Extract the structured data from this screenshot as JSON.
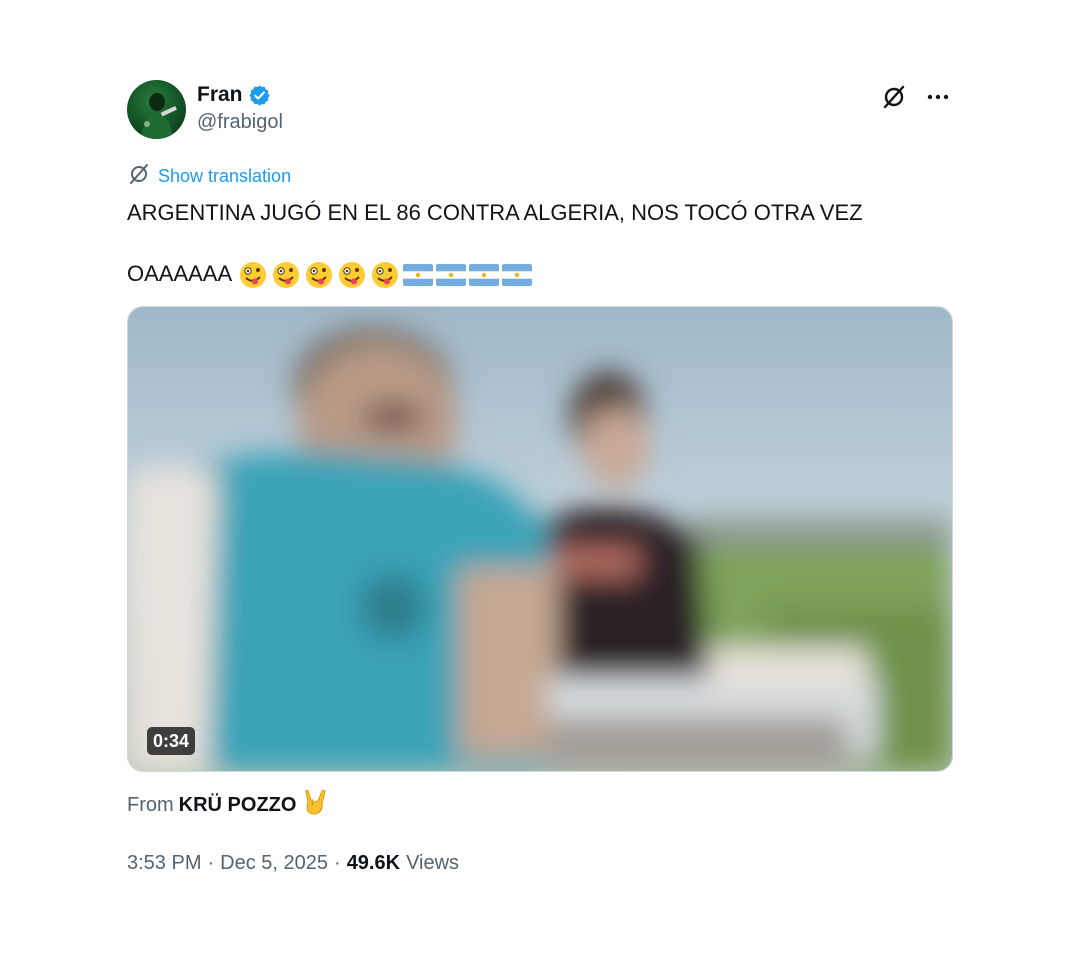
{
  "author": {
    "name": "Fran",
    "handle": "@frabigol",
    "verified": true
  },
  "actions": {
    "grok_icon": "grok-icon",
    "more_icon": "more-icon"
  },
  "translation": {
    "label": "Show translation"
  },
  "tweet": {
    "line1": "ARGENTINA JUGÓ EN EL 86 CONTRA ALGERIA, NOS TOCÓ OTRA VEZ",
    "line2": "OAAAAAA",
    "emojis": [
      "zany-face",
      "zany-face",
      "zany-face",
      "zany-face",
      "zany-face",
      "argentina-flag",
      "argentina-flag",
      "argentina-flag",
      "argentina-flag"
    ]
  },
  "media": {
    "duration": "0:34",
    "type": "video"
  },
  "source": {
    "prefix": "From",
    "name": "KRÜ POZZO",
    "emoji": "sign-of-the-horns"
  },
  "meta": {
    "time": "3:53 PM",
    "separator": "·",
    "date": "Dec 5, 2025",
    "views_count": "49.6K",
    "views_label": "Views"
  },
  "colors": {
    "link": "#1d9bf0",
    "secondary": "#536471",
    "primary": "#0f1419",
    "verified": "#1d9bf0"
  }
}
